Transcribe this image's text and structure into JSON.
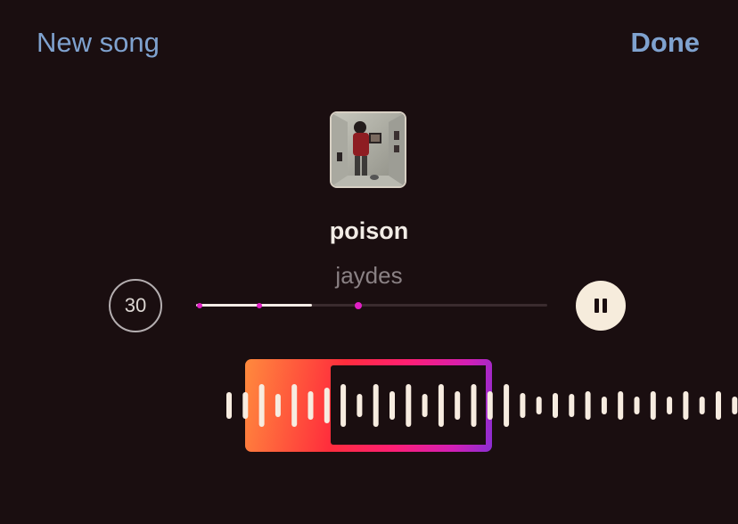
{
  "header": {
    "left_label": "New song",
    "right_label": "Done"
  },
  "track": {
    "title": "poison",
    "artist": "jaydes"
  },
  "clip": {
    "duration_label": "30",
    "progress_fraction": 0.33
  },
  "colors": {
    "accent_link": "#7fa2cf",
    "background": "#1a0e10",
    "selection_start": "#ff8a3d",
    "selection_end": "#8a2ed2"
  },
  "icons": {
    "duration": "timer-30-icon",
    "playback": "pause-icon"
  }
}
